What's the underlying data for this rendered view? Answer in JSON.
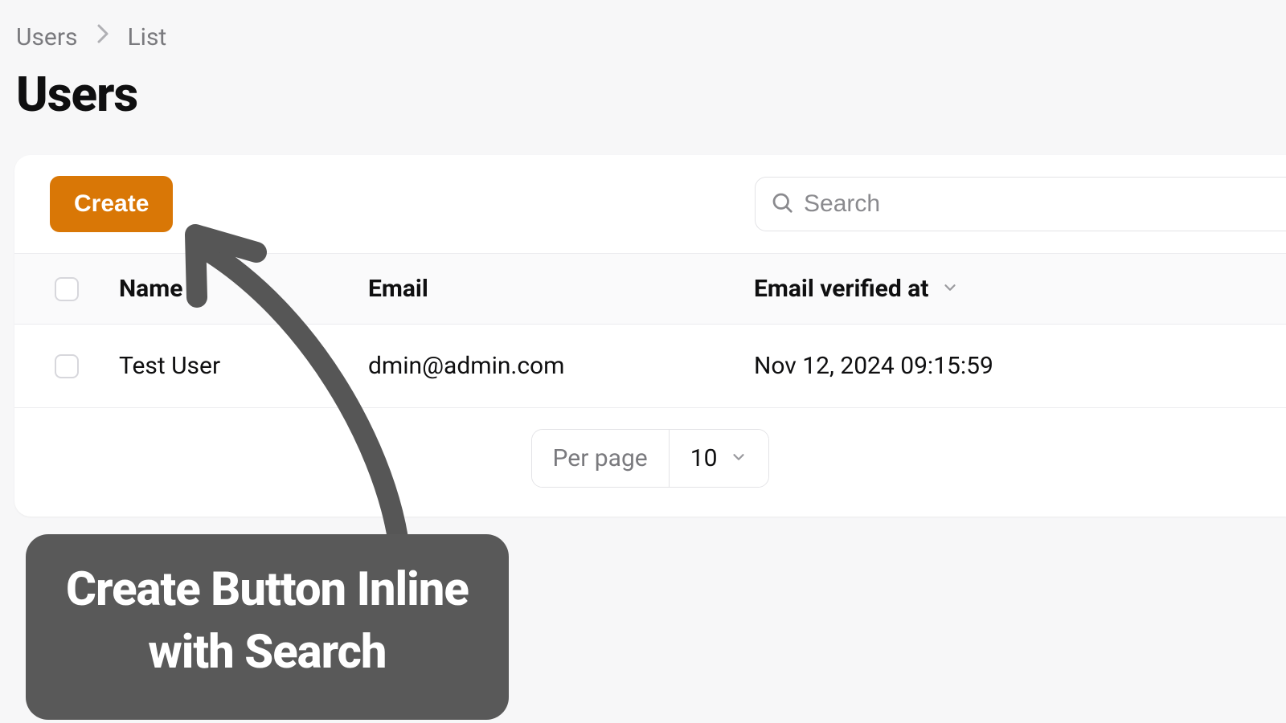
{
  "breadcrumb": {
    "root": "Users",
    "current": "List"
  },
  "page": {
    "title": "Users"
  },
  "toolbar": {
    "create_label": "Create",
    "search_placeholder": "Search"
  },
  "table": {
    "columns": {
      "name": "Name",
      "email": "Email",
      "verified": "Email verified at"
    },
    "rows": [
      {
        "name": "Test User",
        "email": "dmin@admin.com",
        "verified": "Nov 12, 2024 09:15:59"
      }
    ]
  },
  "pagination": {
    "label": "Per page",
    "value": "10"
  },
  "annotation": {
    "line1": "Create Button Inline",
    "line2": "with Search"
  }
}
